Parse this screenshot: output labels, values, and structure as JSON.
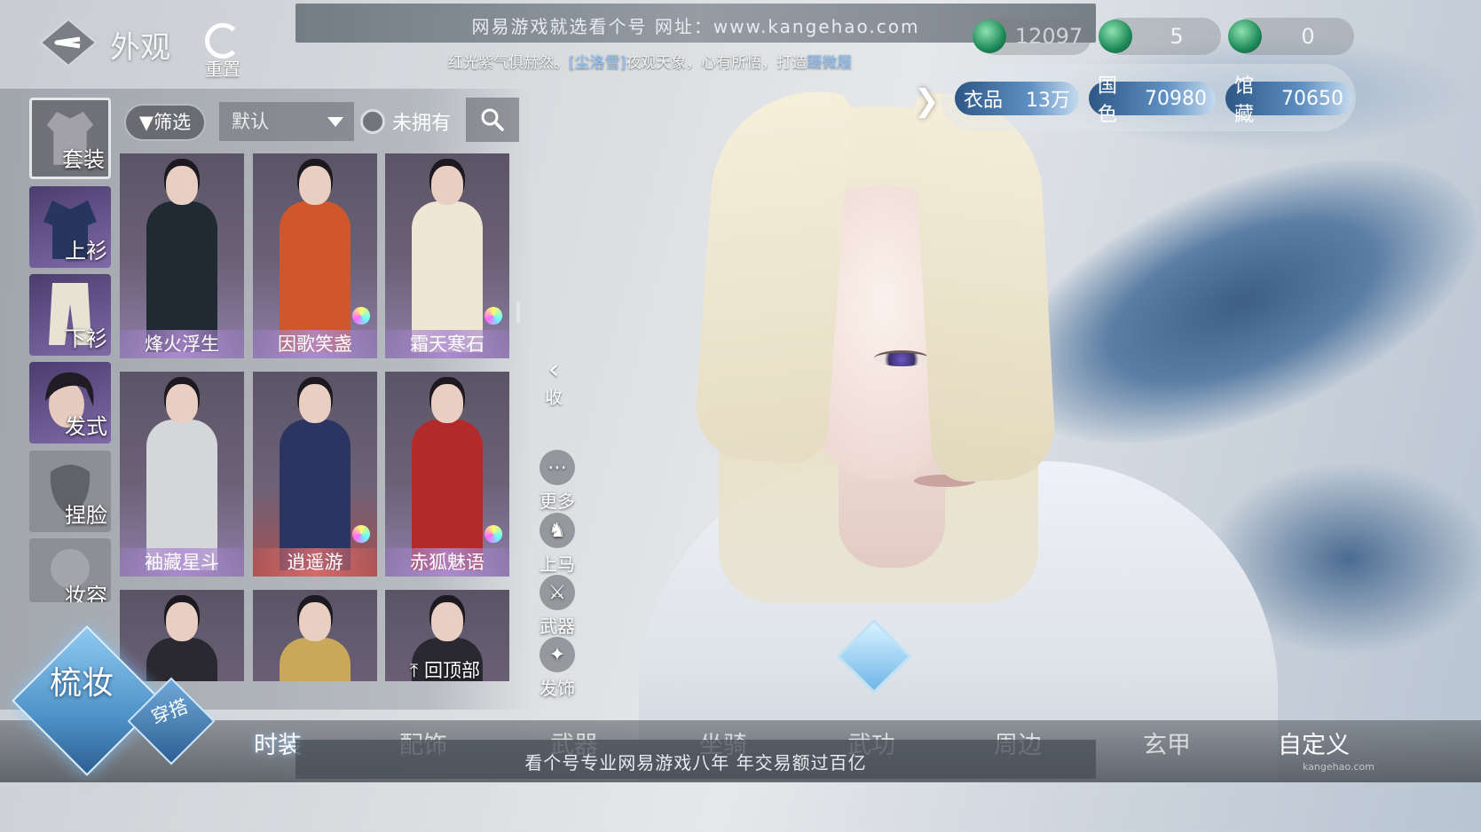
{
  "header": {
    "title": "外观",
    "reset_label": "重置"
  },
  "banner": {
    "top_text": "网易游戏就选看个号  网址：www.kangehao.com",
    "sub_text_prefix": "红光紫气俱赫然。",
    "sub_text_highlight": "[尘洛雪]",
    "sub_text_suffix": "夜观天象，心有所悟，打造",
    "sub_text_tail": "蹑微履",
    "bottom_text": "看个号专业网易游戏八年  年交易额过百亿"
  },
  "currencies": [
    {
      "icon": "jade-coin-icon",
      "value": "12097"
    },
    {
      "icon": "jade-coin-plus-icon",
      "value": "5"
    },
    {
      "icon": "jade-coin-plus-icon",
      "value": "0"
    }
  ],
  "stats": [
    {
      "label": "衣品",
      "value": "13万"
    },
    {
      "label": "国色",
      "value": "70980"
    },
    {
      "label": "馆藏",
      "value": "70650"
    }
  ],
  "categories": [
    {
      "label": "套装",
      "active": true
    },
    {
      "label": "上衫"
    },
    {
      "label": "下衫"
    },
    {
      "label": "发式"
    },
    {
      "label": "捏脸"
    },
    {
      "label": "妆容"
    }
  ],
  "filters": {
    "filter_label": "筛选",
    "sort_value": "默认",
    "owned_label": "未拥有"
  },
  "outfits": [
    {
      "name": "烽火浮生",
      "color": "#1f2a33"
    },
    {
      "name": "因歌笑盏",
      "color": "#d0562b"
    },
    {
      "name": "霜天寒石",
      "color": "#efe7d3"
    },
    {
      "name": "袖藏星斗",
      "color": "#d4d6da"
    },
    {
      "name": "逍遥游",
      "color": "#2c3562"
    },
    {
      "name": "赤狐魅语",
      "color": "#b32a2a"
    },
    {
      "name": "",
      "color": "#2a2830"
    },
    {
      "name": "",
      "color": "#c9a85a"
    },
    {
      "name": "",
      "color": "#2a2830"
    }
  ],
  "back_to_top": "回顶部",
  "side_actions": {
    "collapse": "收",
    "more": "更多",
    "mount": "上马",
    "weapon": "武器",
    "hair_acc": "发饰"
  },
  "bottom_nav": {
    "main_label": "梳妆",
    "sub_label": "穿搭",
    "tabs": [
      "时装",
      "配饰",
      "武器",
      "坐骑",
      "武功",
      "周边",
      "玄甲"
    ],
    "custom": "自定义"
  },
  "watermark": "kangehao.com",
  "colors": {
    "accent_blue": "#5e8fc2",
    "card_purple": "#8f7ea8"
  }
}
